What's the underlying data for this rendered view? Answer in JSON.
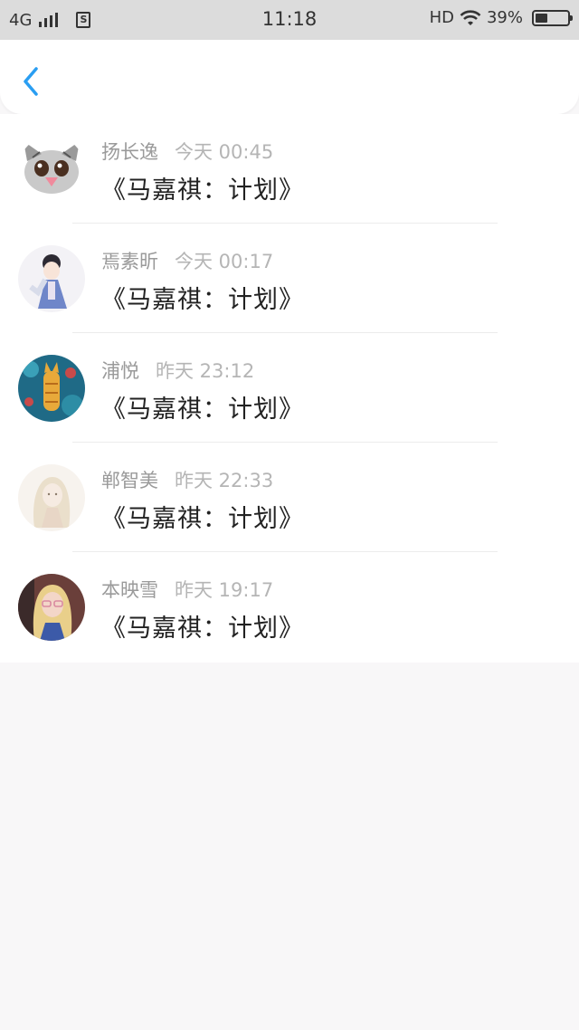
{
  "status_bar": {
    "network": "4G",
    "time": "11:18",
    "hd": "HD",
    "battery_percent": "39%",
    "battery_level": 0.39
  },
  "nav": {
    "back_icon": "chevron-left-icon",
    "accent": "#2a9ef2"
  },
  "items": [
    {
      "name": "扬长逸",
      "time": "今天 00:45",
      "message": "《马嘉祺：计划》"
    },
    {
      "name": "焉素昕",
      "time": "今天 00:17",
      "message": "《马嘉祺：计划》"
    },
    {
      "name": "浦悦",
      "time": "昨天 23:12",
      "message": "《马嘉祺：计划》"
    },
    {
      "name": "郸智美",
      "time": "昨天 22:33",
      "message": "《马嘉祺：计划》"
    },
    {
      "name": "本映雪",
      "time": "昨天 19:17",
      "message": "《马嘉祺：计划》"
    }
  ]
}
